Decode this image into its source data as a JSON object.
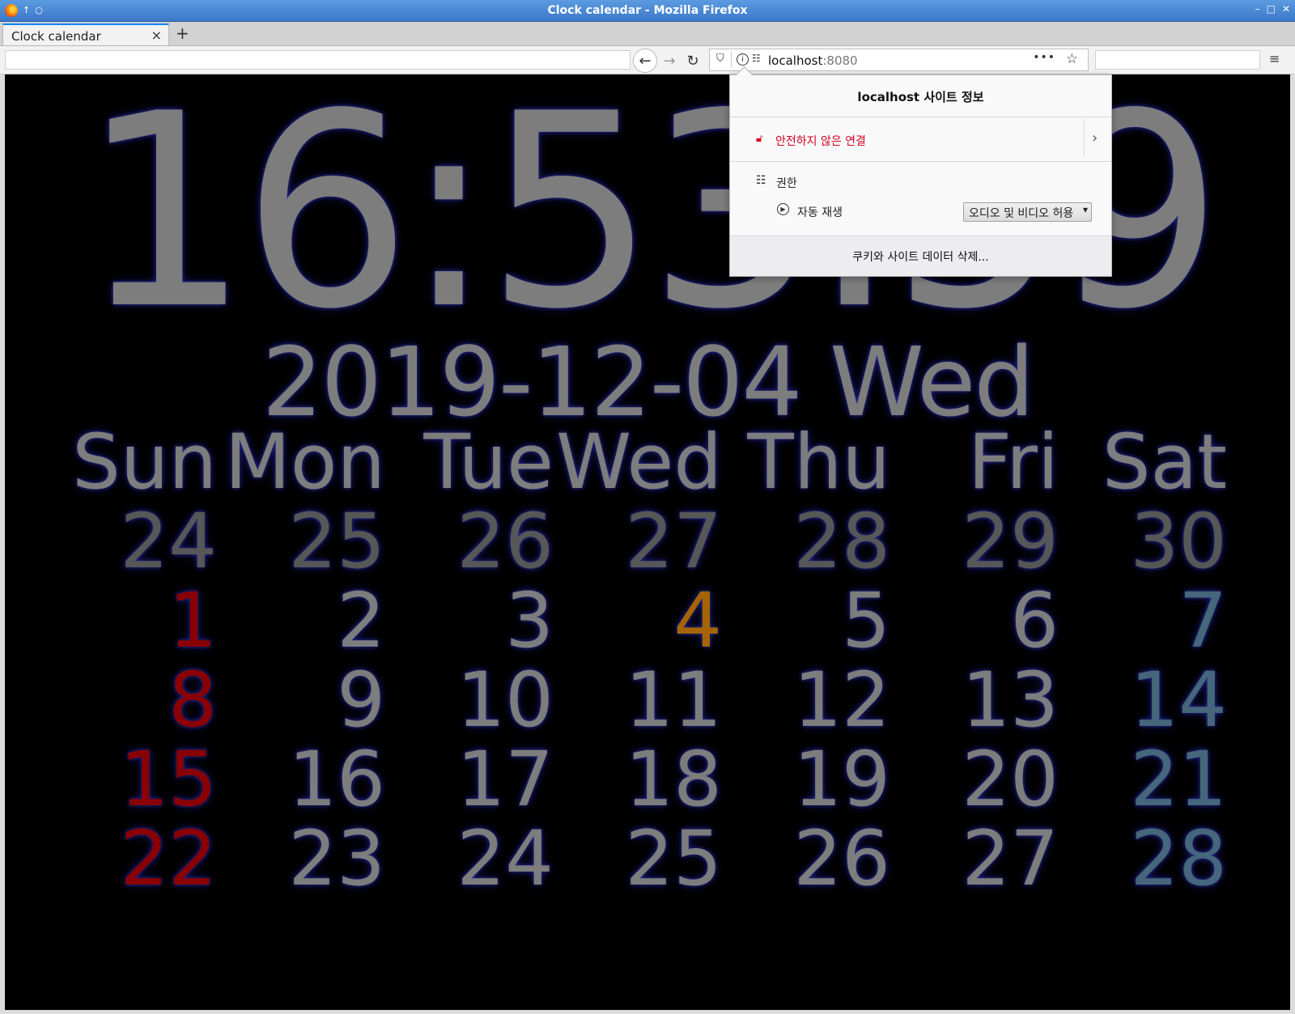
{
  "window": {
    "title": "Clock calendar - Mozilla Firefox",
    "controls": [
      "–",
      "□",
      "✕"
    ]
  },
  "tabs": [
    {
      "label": "Clock calendar",
      "close": "×"
    }
  ],
  "toolbar": {
    "new_tab": "+",
    "back": "←",
    "forward": "→",
    "reload": "↻",
    "url_host": "localhost",
    "url_port": ":8080",
    "page_actions": "•••",
    "bookmark": "☆",
    "menu": "≡"
  },
  "clock": {
    "time": "16:53:59",
    "date": "2019-12-04 Wed"
  },
  "calendar": {
    "weekdays": [
      "Sun",
      "Mon",
      "Tue",
      "Wed",
      "Thu",
      "Fri",
      "Sat"
    ],
    "weeks": [
      [
        "24",
        "25",
        "26",
        "27",
        "28",
        "29",
        "30"
      ],
      [
        "1",
        "2",
        "3",
        "4",
        "5",
        "6",
        "7"
      ],
      [
        "8",
        "9",
        "10",
        "11",
        "12",
        "13",
        "14"
      ],
      [
        "15",
        "16",
        "17",
        "18",
        "19",
        "20",
        "21"
      ],
      [
        "22",
        "23",
        "24",
        "25",
        "26",
        "27",
        "28"
      ]
    ],
    "today": "4",
    "colors": {
      "text": "#7d7d7d",
      "other_month": "#575757",
      "sunday": "#8a0000",
      "saturday": "#45667b",
      "today": "#a66400"
    }
  },
  "site_info_popup": {
    "title": "localhost 사이트 정보",
    "connection": "안전하지 않은 연결",
    "permissions_label": "권한",
    "autoplay_label": "자동 재생",
    "autoplay_value": "오디오 및 비디오 허용",
    "clear_button": "쿠키와 사이트 데이터 삭제..."
  }
}
